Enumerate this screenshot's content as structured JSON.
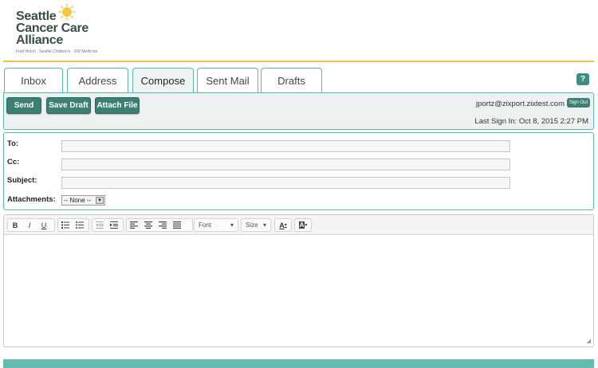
{
  "brand": {
    "line1": "Seattle",
    "line2": "Cancer Care",
    "line3": "Alliance",
    "tagline": "Fred Hutch · Seattle Children's · UW Medicine",
    "accent": "#f2c14e",
    "teal": "#5bb9ac"
  },
  "tabs": [
    {
      "label": "Inbox"
    },
    {
      "label": "Address"
    },
    {
      "label": "Compose",
      "active": true
    },
    {
      "label": "Sent Mail"
    },
    {
      "label": "Drafts"
    }
  ],
  "help": {
    "label": "?"
  },
  "toolbar": {
    "send_label": "Send",
    "save_draft_label": "Save Draft",
    "attach_file_label": "Attach File",
    "user_email": "jportz@zixport.zixtest.com",
    "sign_out_label": "Sign Out",
    "last_sign_in": "Last Sign In: Oct 8, 2015 2:27 PM"
  },
  "form": {
    "to_label": "To:",
    "to_value": "",
    "cc_label": "Cc:",
    "cc_value": "",
    "subject_label": "Subject:",
    "subject_value": "",
    "attachments_label": "Attachments:",
    "attachments_selected": "-- None --"
  },
  "editor": {
    "bold": "B",
    "italic": "I",
    "underline": "U",
    "font_label": "Font",
    "size_label": "Size",
    "text_color_label": "A",
    "bg_color_label": "A",
    "resize_glyph": "◢"
  }
}
